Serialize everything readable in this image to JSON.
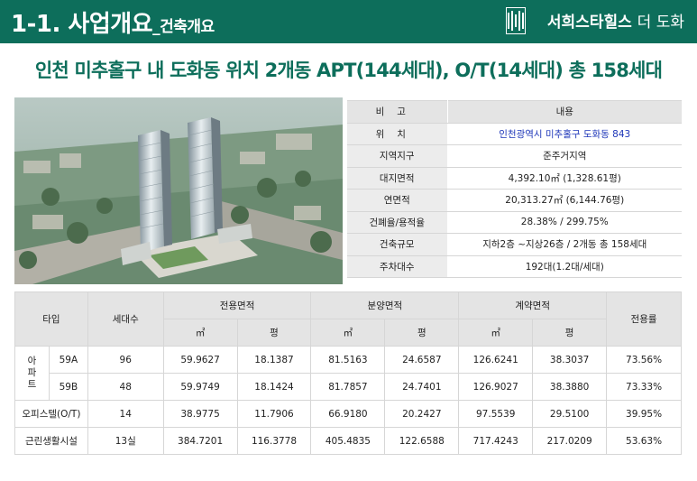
{
  "header": {
    "title_main": "1-1. 사업개요",
    "title_sub": "_건축개요",
    "brand_name": "서희스타힐스",
    "brand_suffix": "더 도화",
    "colors": {
      "brand_green": "#0d6e5b",
      "link_blue": "#1c35b8"
    }
  },
  "headline": "인천 미추홀구 내 도화동 위치 2개동 APT(144세대), O/T(14세대) 총 158세대",
  "info": {
    "header": {
      "key": "비고",
      "value": "내용"
    },
    "rows": [
      {
        "key": "위치",
        "value": "인천광역시 미추홀구 도화동 843"
      },
      {
        "key": "지역지구",
        "value": "준주거지역"
      },
      {
        "key": "대지면적",
        "value": "4,392.10㎡ (1,328.61평)"
      },
      {
        "key": "연면적",
        "value": "20,313.27㎡ (6,144.76평)"
      },
      {
        "key": "건폐율/용적율",
        "value": "28.38% / 299.75%"
      },
      {
        "key": "건축규모",
        "value": "지하2층 ~지상26층 / 2개동 총 158세대"
      },
      {
        "key": "주차대수",
        "value": "192대(1.2대/세대)"
      }
    ]
  },
  "table": {
    "headers": {
      "type": "타입",
      "units": "세대수",
      "exclusive": "전용면적",
      "sale": "분양면적",
      "contract": "계약면적",
      "ratio": "전용률",
      "sqm": "㎡",
      "pyeong": "평"
    },
    "apt_group": [
      "아",
      "파",
      "트"
    ],
    "rows": [
      {
        "type": "59A",
        "units": "96",
        "ex_m": "59.9627",
        "ex_p": "18.1387",
        "sa_m": "81.5163",
        "sa_p": "24.6587",
        "co_m": "126.6241",
        "co_p": "38.3037",
        "ratio": "73.56%"
      },
      {
        "type": "59B",
        "units": "48",
        "ex_m": "59.9749",
        "ex_p": "18.1424",
        "sa_m": "81.7857",
        "sa_p": "24.7401",
        "co_m": "126.9027",
        "co_p": "38.3880",
        "ratio": "73.33%"
      },
      {
        "type": "오피스텔(O/T)",
        "units": "14",
        "ex_m": "38.9775",
        "ex_p": "11.7906",
        "sa_m": "66.9180",
        "sa_p": "20.2427",
        "co_m": "97.5539",
        "co_p": "29.5100",
        "ratio": "39.95%"
      },
      {
        "type": "근린생활시설",
        "units": "13실",
        "ex_m": "384.7201",
        "ex_p": "116.3778",
        "sa_m": "405.4835",
        "sa_p": "122.6588",
        "co_m": "717.4243",
        "co_p": "217.0209",
        "ratio": "53.63%"
      }
    ]
  }
}
